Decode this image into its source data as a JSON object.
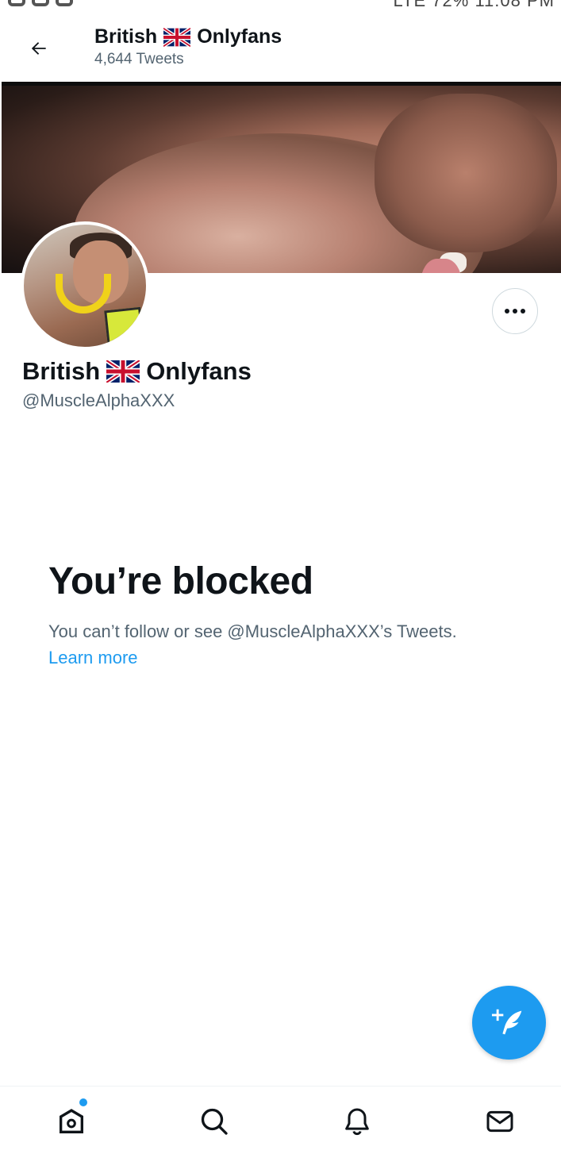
{
  "status_bar": {
    "right_text": "LTE 72% 11:08 PM"
  },
  "header": {
    "name_first": "British",
    "name_last": "Onlyfans",
    "tweets_count": "4,644 Tweets"
  },
  "profile": {
    "name_first": "British",
    "name_last": "Onlyfans",
    "handle": "@MuscleAlphaXXX"
  },
  "blocked": {
    "title": "You’re blocked",
    "description": "You can’t follow or see @MuscleAlphaXXX’s Tweets.",
    "learn_more": "Learn more"
  },
  "colors": {
    "accent": "#1d9bf0",
    "text_primary": "#0f1419",
    "text_secondary": "#536471"
  },
  "icons": [
    "back-arrow-icon",
    "uk-flag-icon",
    "more-icon",
    "compose-tweet-icon",
    "home-icon",
    "search-icon",
    "notifications-icon",
    "messages-icon"
  ]
}
